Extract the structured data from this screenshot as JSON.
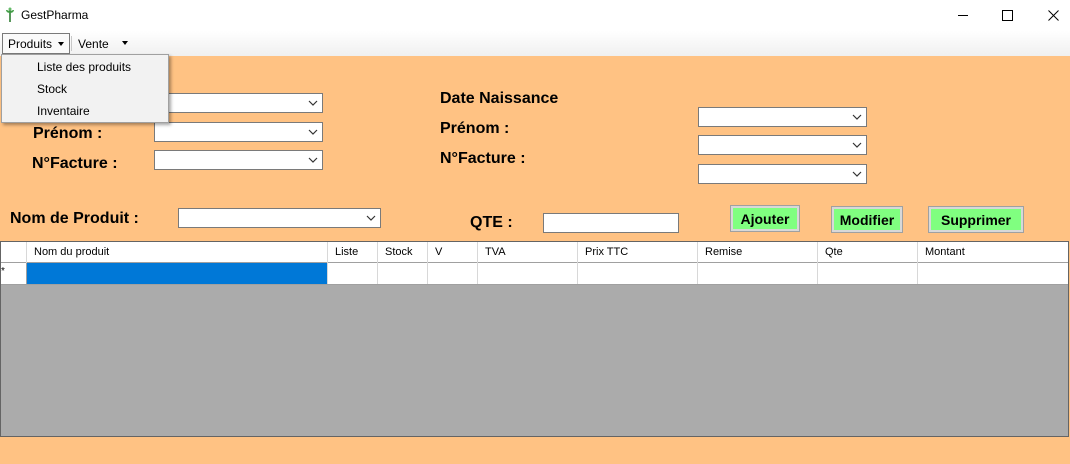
{
  "window": {
    "title": "GestPharma",
    "minimize_icon": "minimize-icon",
    "maximize_icon": "maximize-icon",
    "close_icon": "close-icon",
    "app_icon": "pharmacy-plant-icon"
  },
  "menubar": {
    "produits": "Produits",
    "vente": "Vente"
  },
  "produits_menu": {
    "items": [
      "Liste des produits",
      "Stock",
      "Inventaire"
    ]
  },
  "form": {
    "left": {
      "prenom_label": "Prénom :",
      "facture_label": "N°Facture :"
    },
    "right": {
      "date_label": "Date Naissance",
      "prenom_label": "Prénom :",
      "facture_label": "N°Facture :"
    },
    "nom_produit_label": "Nom de Produit :",
    "qte_label": "QTE :",
    "qte_value": "",
    "buttons": {
      "ajouter": "Ajouter",
      "modifier": "Modifier",
      "supprimer": "Supprimer"
    }
  },
  "grid": {
    "columns": [
      "Nom du produit",
      "Liste",
      "Stock",
      "V",
      "TVA",
      "Prix TTC",
      "Remise",
      "Qte",
      "Montant"
    ],
    "new_row_marker": "*"
  },
  "colors": {
    "form_background": "#ffc283",
    "button_green": "#80ff80",
    "grid_background": "#ababab",
    "selection": "#0078d7"
  }
}
